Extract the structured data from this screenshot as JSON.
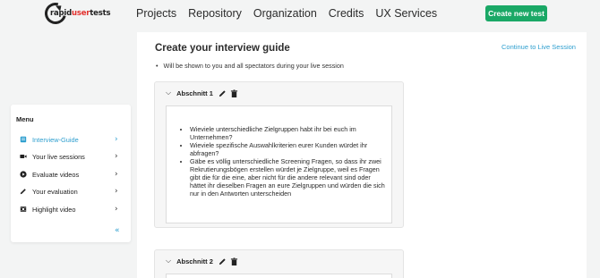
{
  "logo": {
    "part1": "rapid",
    "part2": "user",
    "part3": "tests"
  },
  "nav": [
    {
      "label": "Projects"
    },
    {
      "label": "Repository"
    },
    {
      "label": "Organization"
    },
    {
      "label": "Credits"
    },
    {
      "label": "UX Services"
    }
  ],
  "cta": "Create new test",
  "main": {
    "title": "Create your interview guide",
    "continue_link": "Continue to Live Session",
    "note": "Will be shown to you and all spectators during your live session"
  },
  "sections": [
    {
      "title": "Abschnitt 1",
      "items": [
        "Wieviele unterschiedliche Zielgruppen habt ihr bei euch im Unternehmen?",
        "Wieviele spezifische Auswahlkriterien eurer Kunden würdet ihr abfragen?",
        "Gäbe es völlig unterschiedliche Screening Fragen, so dass ihr zwei Rekrutierungsbögen erstellen würdet je Zielgruppe, weil es Fragen gibt die für die eine, aber nicht für die andere relevant sind oder hättet ihr dieselben Fragen an eure Zielgruppen und würden die sich nur in den Antworten unterscheiden"
      ]
    },
    {
      "title": "Abschnitt 2",
      "items": []
    }
  ],
  "sidebar": {
    "title": "Menu",
    "items": [
      {
        "label": "Interview-Guide",
        "icon": "note-icon"
      },
      {
        "label": "Your live sessions",
        "icon": "video-camera-icon"
      },
      {
        "label": "Evaluate videos",
        "icon": "play-circle-icon"
      },
      {
        "label": "Your evaluation",
        "icon": "pencil-icon"
      },
      {
        "label": "Highlight video",
        "icon": "film-icon"
      }
    ]
  },
  "colors": {
    "accent": "#2f9fcf",
    "cta": "#1aa866",
    "logo_red": "#e2322f"
  }
}
